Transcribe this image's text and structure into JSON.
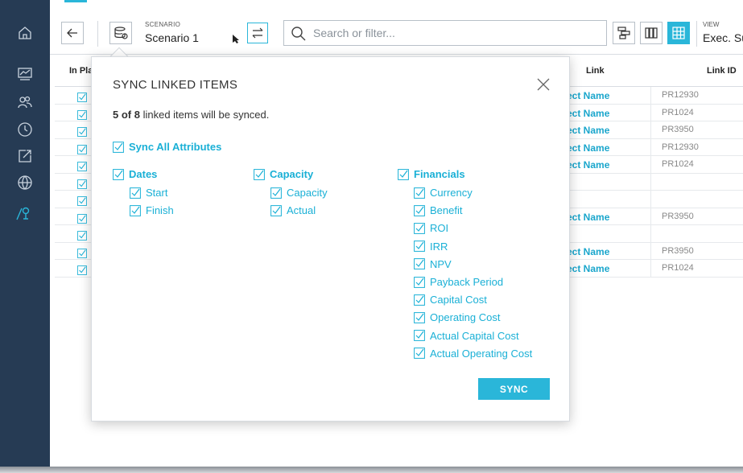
{
  "colors": {
    "accent": "#2ab6d9",
    "sidebar": "#263b54",
    "link": "#1aa6cc"
  },
  "sidebar": {
    "icons": [
      "home-icon",
      "chart-icon",
      "people-icon",
      "clock-icon",
      "export-icon",
      "globe-icon",
      "map-pin-icon"
    ]
  },
  "toolbar": {
    "scenario_label": "SCENARIO",
    "scenario_value": "Scenario 1",
    "search_placeholder": "Search or filter...",
    "view_label": "VIEW",
    "view_value": "Exec. Su"
  },
  "table": {
    "headers": {
      "in_plan": "In Pla",
      "link": "Link",
      "link_id": "Link ID"
    },
    "rows": [
      {
        "link": "ect Name",
        "link_id": "PR12930"
      },
      {
        "link": "ect Name",
        "link_id": "PR1024"
      },
      {
        "link": "ect Name",
        "link_id": "PR3950"
      },
      {
        "link": "ect Name",
        "link_id": "PR12930"
      },
      {
        "link": "ect Name",
        "link_id": "PR1024"
      },
      {
        "link": "",
        "link_id": ""
      },
      {
        "link": "",
        "link_id": ""
      },
      {
        "link": "ect Name",
        "link_id": "PR3950"
      },
      {
        "link": "",
        "link_id": ""
      },
      {
        "link": "ect Name",
        "link_id": "PR3950"
      },
      {
        "link": "ect Name",
        "link_id": "PR1024"
      }
    ]
  },
  "modal": {
    "title": "SYNC LINKED ITEMS",
    "count_strong": "5 of 8",
    "count_rest": " linked items will be synced.",
    "sync_all": "Sync All Attributes",
    "groups": {
      "dates": {
        "label": "Dates",
        "items": [
          "Start",
          "Finish"
        ]
      },
      "capacity": {
        "label": "Capacity",
        "items": [
          "Capacity",
          "Actual"
        ]
      },
      "financials": {
        "label": "Financials",
        "items": [
          "Currency",
          "Benefit",
          "ROI",
          "IRR",
          "NPV",
          "Payback Period",
          "Capital Cost",
          "Operating Cost",
          "Actual Capital Cost",
          "Actual Operating Cost"
        ]
      }
    },
    "sync_button": "SYNC"
  }
}
